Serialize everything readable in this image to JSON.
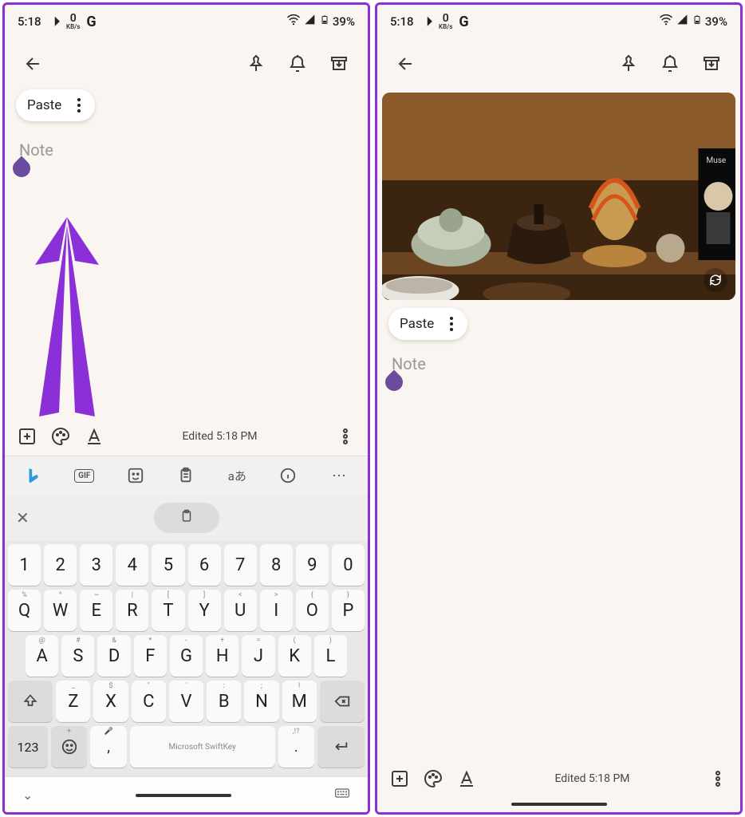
{
  "status": {
    "time": "5:18",
    "kbs_value": "0",
    "kbs_label": "KB/s",
    "battery": "39%"
  },
  "paste": {
    "label": "Paste"
  },
  "note": {
    "placeholder": "Note"
  },
  "bottom": {
    "edited": "Edited 5:18 PM"
  },
  "keyboard": {
    "gif": "GIF",
    "lang": "aあ",
    "row_num": [
      "1",
      "2",
      "3",
      "4",
      "5",
      "6",
      "7",
      "8",
      "9",
      "0"
    ],
    "row_q": [
      "Q",
      "W",
      "E",
      "R",
      "T",
      "Y",
      "U",
      "I",
      "O",
      "P"
    ],
    "row_q_hints": [
      "%",
      "^",
      "~",
      "|",
      "[",
      "]",
      "<",
      ">",
      "{",
      "}"
    ],
    "row_a": [
      "A",
      "S",
      "D",
      "F",
      "G",
      "H",
      "J",
      "K",
      "L"
    ],
    "row_a_hints": [
      "@",
      "#",
      "&",
      "*",
      "-",
      "+",
      "=",
      "(",
      ")"
    ],
    "row_z": [
      "Z",
      "X",
      "C",
      "V",
      "B",
      "N",
      "M"
    ],
    "row_z_hints": [
      "_",
      "$",
      "\"",
      "'",
      ":",
      ";",
      "!"
    ],
    "key_123": "123",
    "space": "Microsoft SwiftKey",
    "comma": ",",
    "comma_hint": "🎤",
    "period": ".",
    "period_hint": ",!?",
    "emoji_hint": "+"
  }
}
